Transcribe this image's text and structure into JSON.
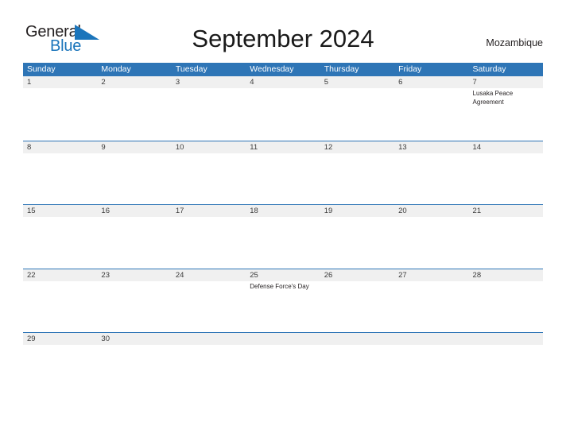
{
  "brand": {
    "name_part1": "General",
    "name_part2": "Blue",
    "flag_icon": "blue-triangle-flag-icon",
    "colors": {
      "dark_text": "#231f20",
      "blue": "#1b75bb"
    }
  },
  "header": {
    "title": "September 2024",
    "country": "Mozambique"
  },
  "calendar": {
    "colors": {
      "header_blue": "#2e75b6",
      "date_band_gray": "#f0f0f0",
      "row_divider": "#2e75b6",
      "day_number_text": "#3a3a3a",
      "event_text": "#231f20"
    },
    "weekdays": [
      "Sunday",
      "Monday",
      "Tuesday",
      "Wednesday",
      "Thursday",
      "Friday",
      "Saturday"
    ],
    "weeks": [
      [
        {
          "day": "1",
          "events": []
        },
        {
          "day": "2",
          "events": []
        },
        {
          "day": "3",
          "events": []
        },
        {
          "day": "4",
          "events": []
        },
        {
          "day": "5",
          "events": []
        },
        {
          "day": "6",
          "events": []
        },
        {
          "day": "7",
          "events": [
            "Lusaka Peace Agreement"
          ]
        }
      ],
      [
        {
          "day": "8",
          "events": []
        },
        {
          "day": "9",
          "events": []
        },
        {
          "day": "10",
          "events": []
        },
        {
          "day": "11",
          "events": []
        },
        {
          "day": "12",
          "events": []
        },
        {
          "day": "13",
          "events": []
        },
        {
          "day": "14",
          "events": []
        }
      ],
      [
        {
          "day": "15",
          "events": []
        },
        {
          "day": "16",
          "events": []
        },
        {
          "day": "17",
          "events": []
        },
        {
          "day": "18",
          "events": []
        },
        {
          "day": "19",
          "events": []
        },
        {
          "day": "20",
          "events": []
        },
        {
          "day": "21",
          "events": []
        }
      ],
      [
        {
          "day": "22",
          "events": []
        },
        {
          "day": "23",
          "events": []
        },
        {
          "day": "24",
          "events": []
        },
        {
          "day": "25",
          "events": [
            "Defense Force's Day"
          ]
        },
        {
          "day": "26",
          "events": []
        },
        {
          "day": "27",
          "events": []
        },
        {
          "day": "28",
          "events": []
        }
      ],
      [
        {
          "day": "29",
          "events": []
        },
        {
          "day": "30",
          "events": []
        },
        {
          "day": "",
          "events": []
        },
        {
          "day": "",
          "events": []
        },
        {
          "day": "",
          "events": []
        },
        {
          "day": "",
          "events": []
        },
        {
          "day": "",
          "events": []
        }
      ]
    ]
  }
}
